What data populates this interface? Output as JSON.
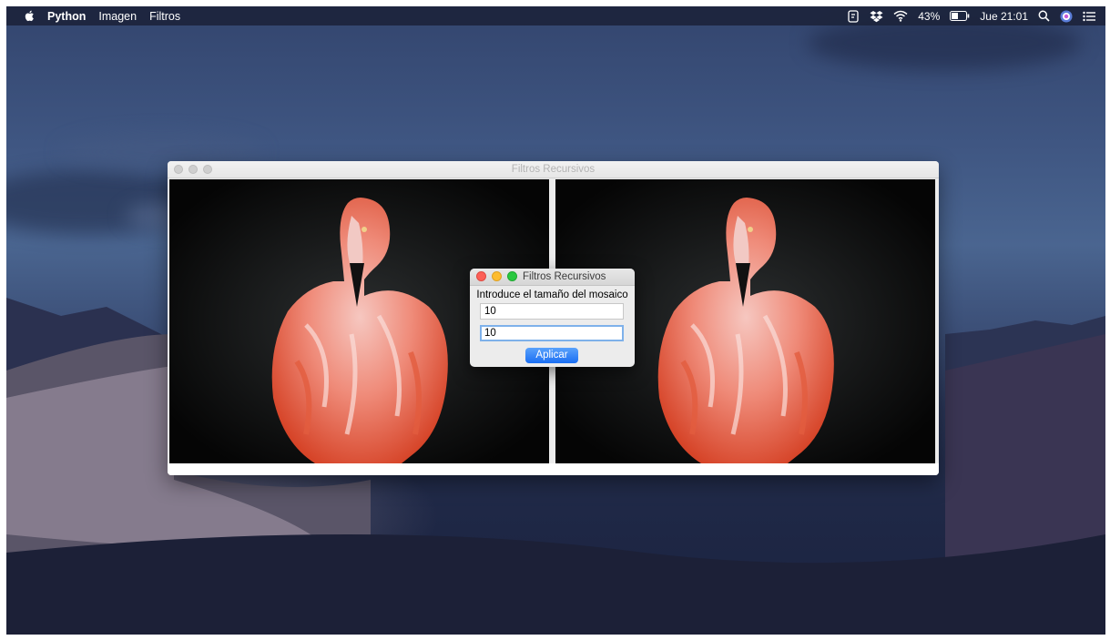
{
  "menubar": {
    "app_name": "Python",
    "menus": [
      "Imagen",
      "Filtros"
    ],
    "battery": "43%",
    "clock": "Jue 21:01"
  },
  "main_window": {
    "title": "Filtros Recursivos"
  },
  "dialog": {
    "title": "Filtros Recursivos",
    "prompt": "Introduce el tamaño del mosaico",
    "field1_value": "10",
    "field2_value": "10",
    "apply_label": "Aplicar"
  },
  "icons": [
    "apple-icon",
    "evernote-icon",
    "dropbox-icon",
    "wifi-icon",
    "battery-icon",
    "search-icon",
    "siri-icon",
    "notification-center-icon"
  ]
}
